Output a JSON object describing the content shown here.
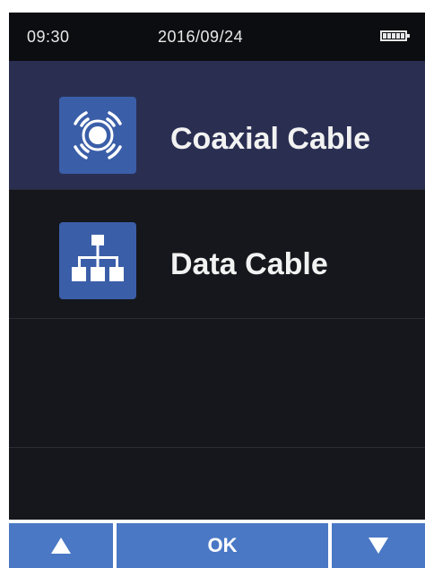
{
  "status": {
    "time": "09:30",
    "date": "2016/09/24",
    "battery_icon": "battery-full-icon"
  },
  "menu": {
    "items": [
      {
        "label": "Coaxial Cable",
        "icon": "coaxial-cable-icon",
        "selected": true
      },
      {
        "label": "Data Cable",
        "icon": "network-tree-icon",
        "selected": false
      }
    ]
  },
  "softkeys": {
    "up_icon": "triangle-up-icon",
    "ok_label": "OK",
    "down_icon": "triangle-down-icon"
  },
  "colors": {
    "screen_bg": "#15171c",
    "status_bar_bg": "#0c0d10",
    "selected_row_bg": "#2a2f52",
    "icon_tile_bg": "#3b5ea8",
    "softkey_bg": "#4a78c4"
  }
}
